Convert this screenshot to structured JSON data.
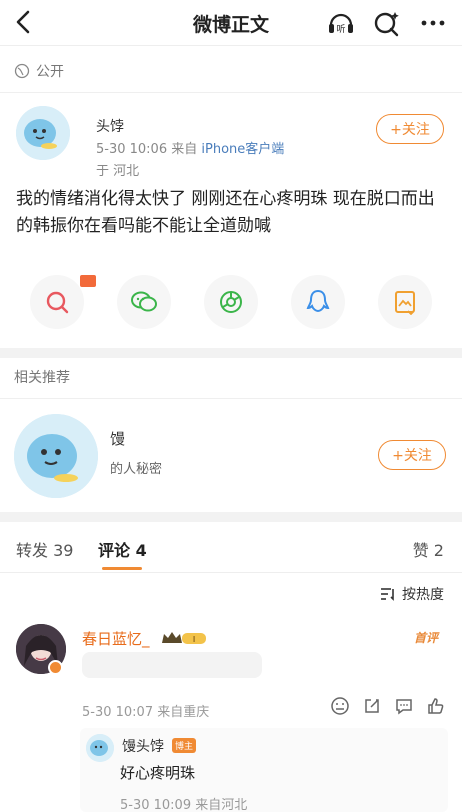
{
  "header": {
    "title": "微博正文",
    "icons": [
      "back-icon",
      "listen-icon",
      "search-icon",
      "more-icon"
    ],
    "listen_label": "听"
  },
  "visibility": {
    "label": "公开",
    "icon": "globe-icon"
  },
  "post": {
    "author_name": "头饽",
    "meta_time": "5-30 10:06",
    "meta_from": "来自",
    "meta_client": "iPhone客户端",
    "location": "于 河北",
    "text": "我的情绪消化得太快了 刚刚还在心疼明珠 现在脱口而出的韩振你在看吗能不能让全道勋喊",
    "follow_label": "+关注"
  },
  "share": [
    "search-share-icon",
    "wechat-icon",
    "moments-icon",
    "qq-icon",
    "save-image-icon"
  ],
  "recommend": {
    "section_label": "相关推荐",
    "name": "馒",
    "desc": "的人秘密",
    "follow_label": "+关注"
  },
  "tabs": {
    "repost": "转发 39",
    "comment": "评论 4",
    "like": "赞 2"
  },
  "sort": {
    "label": "按热度"
  },
  "comment": {
    "name": "春日蓝忆_",
    "level_badge": "I",
    "top_tag": "首评",
    "meta": "5-30 10:07 来自重庆",
    "reply": {
      "name": "馒头饽",
      "tag": "博主",
      "text": "好心疼明珠",
      "meta": "5-30 10:09 来自河北"
    }
  },
  "colors": {
    "accent": "#f08a33",
    "link": "#4a7dbb",
    "comment_name": "#e86b1a"
  }
}
